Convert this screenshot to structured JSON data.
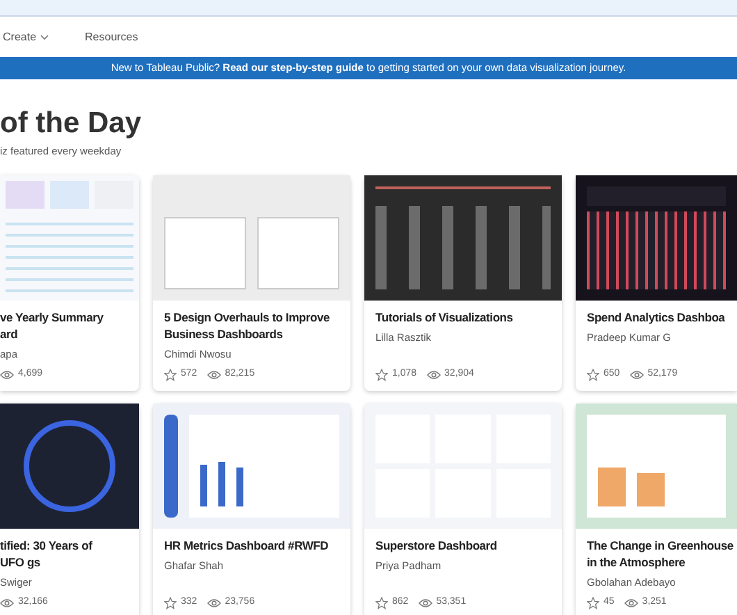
{
  "nav": {
    "items": [
      {
        "label": "Create",
        "kind": "dropdown"
      },
      {
        "label": "Resources",
        "kind": "link"
      }
    ]
  },
  "banner": {
    "text": "New to Tableau Public? **Read our step-by-step guide** to getting started on your own data visualization journey."
  },
  "section": {
    "title": "of the Day",
    "subtitle": "iz featured every weekday"
  },
  "cards": [
    {
      "title": "ve Yearly Summary ard",
      "author": "apa",
      "views": "4,699",
      "kind": "pastel"
    },
    {
      "title": "5 Design Overhauls to Improve Business Dashboards",
      "author": "Chimdi Nwosu",
      "favorites": "572",
      "views": "82,215",
      "kind": "gray"
    },
    {
      "title": "Tutorials of Visualizations",
      "author": "Lilla Rasztik",
      "favorites": "1,078",
      "views": "32,904",
      "kind": "charcoal"
    },
    {
      "title": "Spend Analytics Dashboa",
      "author": "Pradeep Kumar G",
      "favorites": "650",
      "views": "52,179",
      "kind": "dark"
    },
    {
      "title": "tified: 30 Years of UFO gs",
      "author": "Swiger",
      "views": "32,166",
      "kind": "ring"
    },
    {
      "title": "HR Metrics Dashboard #RWFD",
      "author": "Ghafar Shah",
      "favorites": "332",
      "views": "23,756",
      "kind": "sidebar"
    },
    {
      "title": "Superstore Dashboard",
      "author": "Priya Padham",
      "favorites": "862",
      "views": "53,351",
      "kind": "light"
    },
    {
      "title": "The Change in Greenhouse in the Atmosphere",
      "author": "Gbolahan Adebayo",
      "favorites": "45",
      "views": "3,251",
      "kind": "green"
    }
  ]
}
